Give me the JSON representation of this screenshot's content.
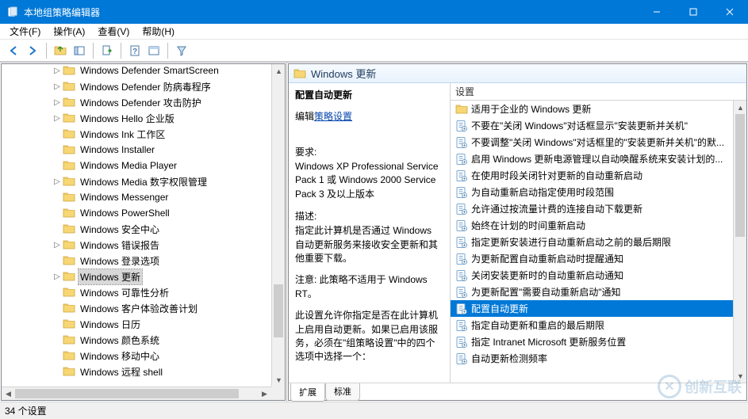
{
  "titlebar": {
    "title": "本地组策略编辑器"
  },
  "menubar": {
    "file": "文件(F)",
    "action": "操作(A)",
    "view": "查看(V)",
    "help": "帮助(H)"
  },
  "tree": {
    "items": [
      "Windows Defender SmartScreen",
      "Windows Defender 防病毒程序",
      "Windows Defender 攻击防护",
      "Windows Hello 企业版",
      "Windows Ink 工作区",
      "Windows Installer",
      "Windows Media Player",
      "Windows Media 数字权限管理",
      "Windows Messenger",
      "Windows PowerShell",
      "Windows 安全中心",
      "Windows 错误报告",
      "Windows 登录选项",
      "Windows 更新",
      "Windows 可靠性分析",
      "Windows 客户体验改善计划",
      "Windows 日历",
      "Windows 颜色系统",
      "Windows 移动中心",
      "Windows 远程 shell"
    ],
    "selected_index": 13,
    "expander_index": 13,
    "has_children_indices": [
      0,
      1,
      2,
      3,
      7,
      11,
      13
    ]
  },
  "right": {
    "header": "Windows 更新",
    "desc": {
      "policy_title": "配置自动更新",
      "edit_link_prefix": "编辑",
      "edit_link": "策略设置",
      "req_label": "要求:",
      "req_text": "Windows XP Professional Service Pack 1 或 Windows 2000 Service Pack 3 及以上版本",
      "desc_label": "描述:",
      "desc_text": "指定此计算机是否通过 Windows 自动更新服务来接收安全更新和其他重要下载。",
      "note_text": "注意: 此策略不适用于 Windows RT。",
      "extra_text": "此设置允许你指定是否在此计算机上启用自动更新。如果已启用该服务，必须在\"组策略设置\"中的四个选项中选择一个："
    },
    "list": {
      "header": "设置",
      "items": [
        {
          "icon": "folder",
          "label": "适用于企业的 Windows 更新"
        },
        {
          "icon": "policy",
          "label": "不要在\"关闭 Windows\"对话框显示\"安装更新并关机\""
        },
        {
          "icon": "policy",
          "label": "不要调整\"关闭 Windows\"对话框里的\"安装更新并关机\"的默..."
        },
        {
          "icon": "policy",
          "label": "启用 Windows 更新电源管理以自动唤醒系统来安装计划的..."
        },
        {
          "icon": "policy",
          "label": "在使用时段关闭针对更新的自动重新启动"
        },
        {
          "icon": "policy",
          "label": "为自动重新启动指定使用时段范围"
        },
        {
          "icon": "policy",
          "label": "允许通过按流量计费的连接自动下载更新"
        },
        {
          "icon": "policy",
          "label": "始终在计划的时间重新启动"
        },
        {
          "icon": "policy",
          "label": "指定更新安装进行自动重新启动之前的最后期限"
        },
        {
          "icon": "policy",
          "label": "为更新配置自动重新启动时提醒通知"
        },
        {
          "icon": "policy",
          "label": "关闭安装更新时的自动重新启动通知"
        },
        {
          "icon": "policy",
          "label": "为更新配置\"需要自动重新启动\"通知"
        },
        {
          "icon": "policy",
          "label": "配置自动更新",
          "selected": true
        },
        {
          "icon": "policy",
          "label": "指定自动更新和重启的最后期限"
        },
        {
          "icon": "policy",
          "label": "指定 Intranet Microsoft 更新服务位置"
        },
        {
          "icon": "policy",
          "label": "自动更新检测频率"
        }
      ]
    },
    "tabs": {
      "extended": "扩展",
      "standard": "标准"
    }
  },
  "statusbar": {
    "count": "34 个设置"
  },
  "watermark": {
    "text": "创新互联"
  }
}
